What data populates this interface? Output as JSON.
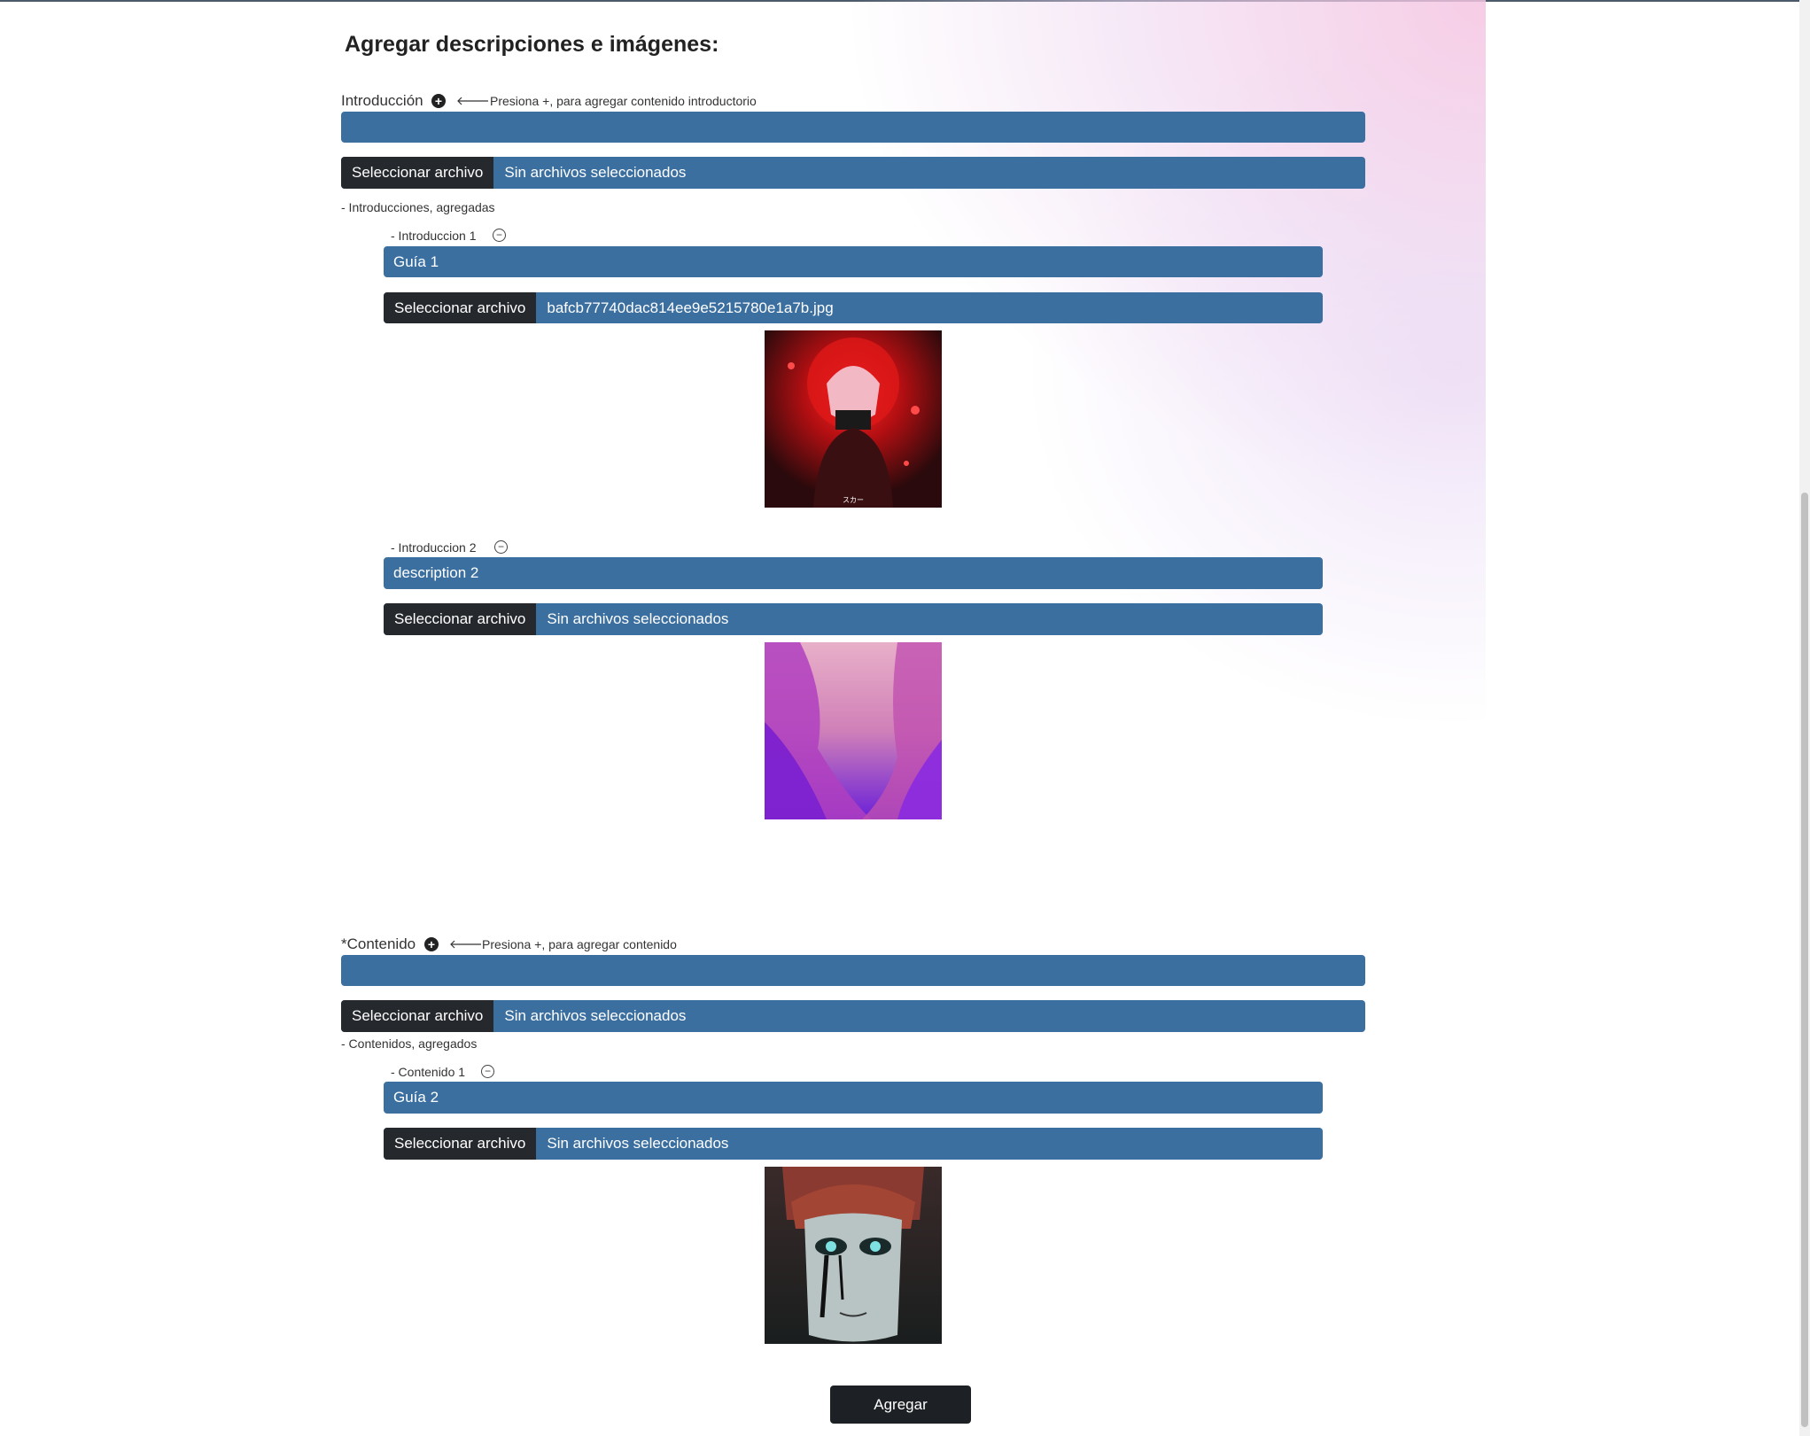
{
  "heading": "Agregar descripciones e imágenes:",
  "intro": {
    "label": "Introducción",
    "hint": "Presiona +, para agregar contenido introductorio",
    "text_value": "",
    "file_button": "Seleccionar archivo",
    "file_status": "Sin archivos seleccionados",
    "added_label": "- Introducciones, agregadas",
    "items": [
      {
        "label": "- Introduccion 1",
        "text_value": "Guía 1",
        "file_button": "Seleccionar archivo",
        "file_name": "bafcb77740dac814ee9e5215780e1a7b.jpg",
        "image_caption": "スカー"
      },
      {
        "label": "- Introduccion 2",
        "text_value": "description 2",
        "file_button": "Seleccionar archivo",
        "file_name": "Sin archivos seleccionados"
      }
    ]
  },
  "content": {
    "label": "*Contenido",
    "hint": "Presiona +, para agregar contenido",
    "text_value": "",
    "file_button": "Seleccionar archivo",
    "file_status": "Sin archivos seleccionados",
    "added_label": "- Contenidos, agregados",
    "items": [
      {
        "label": "- Contenido 1",
        "text_value": "Guía 2",
        "file_button": "Seleccionar archivo",
        "file_name": "Sin archivos seleccionados"
      }
    ]
  },
  "submit_label": "Agregar",
  "icons": {
    "add": "plus-circle-icon",
    "remove": "minus-circle-icon",
    "arrow": "arrow-left-icon"
  },
  "colors": {
    "input_bg": "#3b6fa0",
    "file_button_bg": "#25282c",
    "submit_bg": "#1d2125",
    "gradient_pink": "#f4c4e1"
  }
}
